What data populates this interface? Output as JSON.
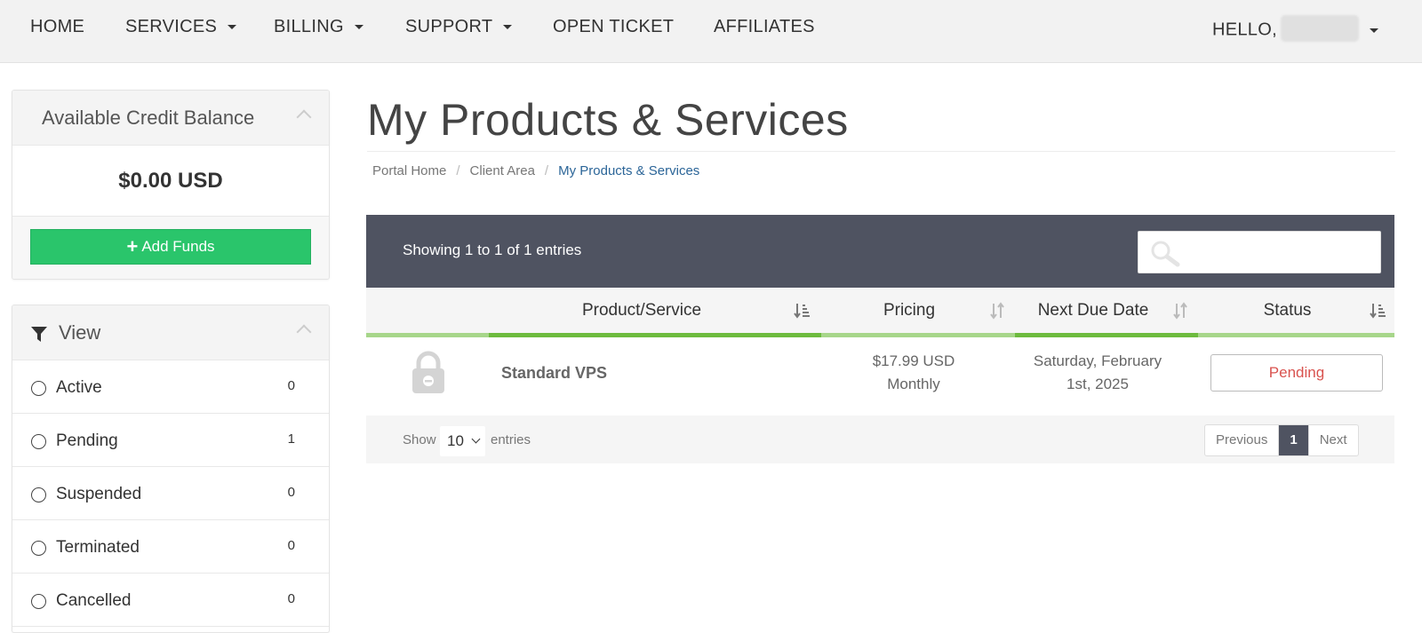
{
  "nav": {
    "home": "HOME",
    "services": "SERVICES",
    "billing": "BILLING",
    "support": "SUPPORT",
    "open_ticket": "OPEN TICKET",
    "affiliates": "AFFILIATES",
    "hello": "HELLO,"
  },
  "credit_panel": {
    "title": "Available Credit Balance",
    "amount": "$0.00 USD",
    "button": "Add Funds"
  },
  "view_panel": {
    "title": "View",
    "statuses": [
      {
        "label": "Active",
        "count": "0"
      },
      {
        "label": "Pending",
        "count": "1"
      },
      {
        "label": "Suspended",
        "count": "0"
      },
      {
        "label": "Terminated",
        "count": "0"
      },
      {
        "label": "Cancelled",
        "count": "0"
      }
    ]
  },
  "page": {
    "title": "My Products & Services",
    "breadcrumb": [
      "Portal Home",
      "Client Area",
      "My Products & Services"
    ]
  },
  "table": {
    "showing": "Showing 1 to 1 of 1 entries",
    "search_placeholder": "",
    "columns": [
      "Product/Service",
      "Pricing",
      "Next Due Date",
      "Status"
    ],
    "rows": [
      {
        "product": "Standard VPS",
        "price": "$17.99 USD",
        "cycle": "Monthly",
        "due_line1": "Saturday, February",
        "due_line2": "1st, 2025",
        "status": "Pending"
      }
    ],
    "footer": {
      "show": "Show",
      "page_length": "10",
      "entries": "entries",
      "previous": "Previous",
      "current_page": "1",
      "next": "Next"
    }
  },
  "colors": {
    "accent_green": "#2ac56b",
    "header_dark": "#4f5361",
    "sorted_bar": "#6dbb3e",
    "unsorted_bar": "#a7d68a",
    "pending_red": "#d9534f",
    "link_blue": "#2b6598"
  }
}
